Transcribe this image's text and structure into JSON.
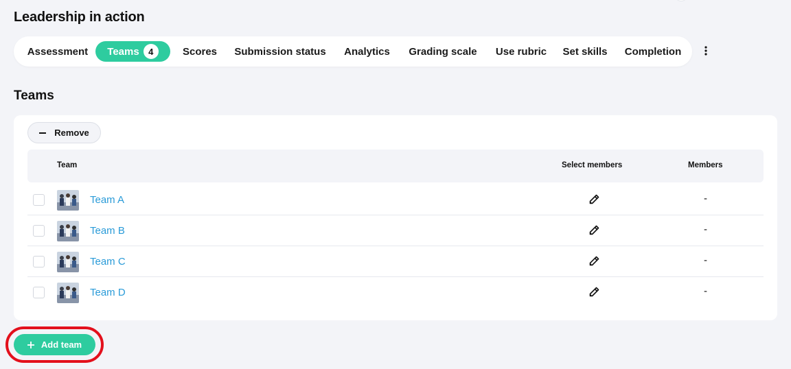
{
  "page": {
    "title": "Leadership in action"
  },
  "tabs": [
    {
      "label": "Assessment"
    },
    {
      "label": "Teams",
      "badge": "4",
      "active": true
    },
    {
      "label": "Scores"
    },
    {
      "label": "Submission status"
    },
    {
      "label": "Analytics"
    },
    {
      "label": "Grading scale"
    },
    {
      "label": "Use rubric"
    },
    {
      "label": "Set skills"
    },
    {
      "label": "Completion"
    }
  ],
  "more_menu_icon": "kebab-vertical-icon",
  "section": {
    "title": "Teams"
  },
  "toolbar": {
    "remove_label": "Remove",
    "remove_icon": "minus-icon"
  },
  "table": {
    "columns": {
      "team": "Team",
      "select_members": "Select members",
      "members": "Members"
    },
    "rows": [
      {
        "name": "Team A",
        "members": "-"
      },
      {
        "name": "Team B",
        "members": "-"
      },
      {
        "name": "Team C",
        "members": "-"
      },
      {
        "name": "Team D",
        "members": "-"
      }
    ]
  },
  "add_team": {
    "label": "Add team",
    "icon": "plus-icon"
  },
  "colors": {
    "accent": "#2ecc9f",
    "link": "#2a9bd8",
    "highlight": "#e3101c",
    "background": "#f3f4f8"
  }
}
